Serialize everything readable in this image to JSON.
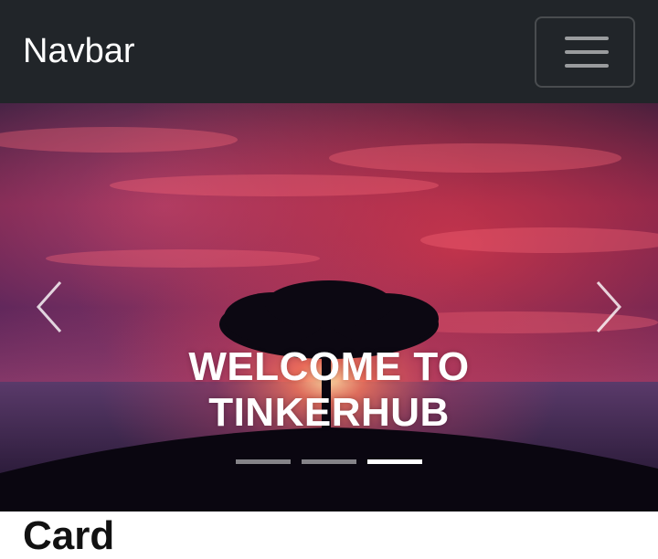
{
  "navbar": {
    "brand": "Navbar",
    "toggler_icon": "hamburger-icon"
  },
  "carousel": {
    "caption_line1": "WELCOME TO",
    "caption_line2": "TINKERHUB",
    "prev_icon": "chevron-left-icon",
    "next_icon": "chevron-right-icon",
    "slide_count": 3,
    "active_slide": 3
  },
  "section": {
    "title_partial": "Card"
  },
  "colors": {
    "navbar_bg": "#212529",
    "text": "#ffffff"
  }
}
